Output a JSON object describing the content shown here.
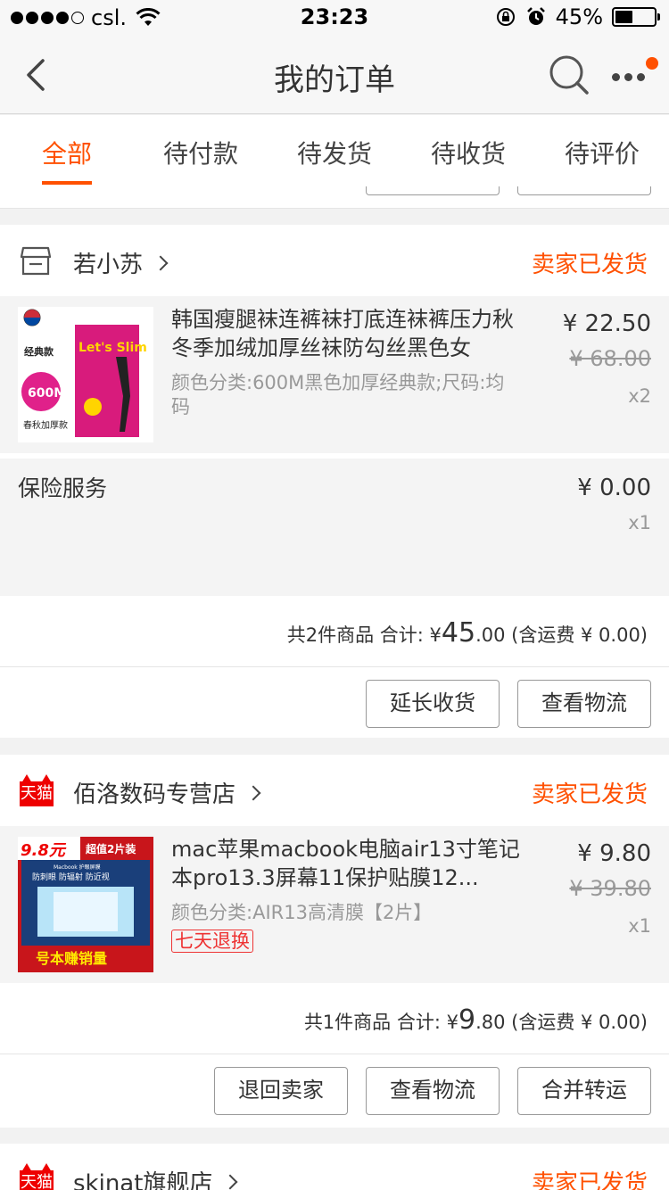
{
  "status_bar": {
    "carrier": "csl.",
    "time": "23:23",
    "battery": "45%",
    "battery_level": 0.45
  },
  "nav": {
    "title": "我的订单"
  },
  "tabs": [
    {
      "label": "全部",
      "active": true
    },
    {
      "label": "待付款",
      "active": false
    },
    {
      "label": "待发货",
      "active": false
    },
    {
      "label": "待收货",
      "active": false
    },
    {
      "label": "待评价",
      "active": false
    }
  ],
  "orders": [
    {
      "shop_name": "若小苏",
      "status": "卖家已发货",
      "item": {
        "title": "韩国瘦腿袜连裤袜打底连袜裤压力秋冬季加绒加厚丝袜防勾丝黑色女",
        "spec": "颜色分类:600M黑色加厚经典款;尺码:均码",
        "price": "¥ 22.50",
        "original_price": "¥ 68.00",
        "qty": "x2",
        "thumb_text": {
          "top_label": "经典款",
          "brand": "Let's Slim",
          "badge": "600M",
          "bottom_label": "春秋加厚款"
        }
      },
      "extra": {
        "title": "保险服务",
        "price": "¥ 0.00",
        "qty": "x1"
      },
      "summary": {
        "prefix": "共2件商品 合计: ¥",
        "amount_big": "45",
        "amount_small": ".00",
        "suffix": " (含运费 ¥ 0.00)"
      },
      "buttons": [
        "延长收货",
        "查看物流"
      ]
    },
    {
      "shop_name": "佰洛数码专营店",
      "status": "卖家已发货",
      "shop_badge": "天猫",
      "item": {
        "title": "mac苹果macbook电脑air13寸笔记本pro13.3屏幕11保护贴膜12...",
        "spec": "颜色分类:AIR13高清膜【2片】",
        "tag": "七天退换",
        "price": "¥ 9.80",
        "original_price": "¥ 39.80",
        "qty": "x1",
        "thumb_text": {
          "price_tag": "9.8元",
          "deal": "超值2片装",
          "sub": "Macbook 护眼屏膜",
          "features": "防刺眼  防辐射  防近视",
          "footer": "号本赚销量"
        }
      },
      "summary": {
        "prefix": "共1件商品 合计: ¥",
        "amount_big": "9",
        "amount_small": ".80",
        "suffix": " (含运费 ¥ 0.00)"
      },
      "buttons": [
        "退回卖家",
        "查看物流",
        "合并转运"
      ]
    },
    {
      "shop_name": "skinat旗舰店",
      "status": "卖家已发货",
      "shop_badge": "天猫"
    }
  ],
  "colors": {
    "accent": "#ff5000",
    "tmall_red": "#ee0000",
    "background": "#f2f2f2"
  }
}
